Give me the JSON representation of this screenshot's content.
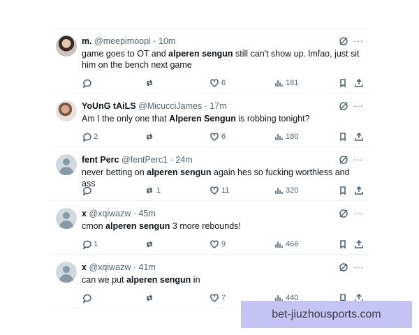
{
  "tweets": [
    {
      "name": "m.",
      "handle": "@meepimoopi",
      "time": "10m",
      "text_before": "game goes to OT and ",
      "highlight": "alperen sengun",
      "text_after": " still can't show up. lmfao, just sit him on the bench next game",
      "replies": "",
      "retweets": "",
      "likes": "6",
      "views": "181"
    },
    {
      "name": "YoUnG tAiLS",
      "handle": "@MicucciJames",
      "time": "17m",
      "text_before": "Am I the only one that ",
      "highlight": "Alperen Sengun",
      "text_after": " is robbing tonight?",
      "replies": "2",
      "retweets": "",
      "likes": "6",
      "views": "180"
    },
    {
      "name": "fent Perc",
      "handle": "@fentPerc1",
      "time": "24m",
      "text_before": "never betting on ",
      "highlight": "alperen sengun",
      "text_after": " again hes so fucking worthless and ass",
      "replies": "",
      "retweets": "1",
      "likes": "11",
      "views": "320"
    },
    {
      "name": "x",
      "handle": "@xqiwazw",
      "time": "45m",
      "text_before": "cmon ",
      "highlight": "alperen sengun",
      "text_after": " 3 more rebounds!",
      "replies": "1",
      "retweets": "",
      "likes": "9",
      "views": "466"
    },
    {
      "name": "x",
      "handle": "@xqiwazw",
      "time": "41m",
      "text_before": "can we put ",
      "highlight": "alperen sengun",
      "text_after": " in",
      "replies": "",
      "retweets": "",
      "likes": "7",
      "views": "440"
    }
  ],
  "separator": "·",
  "more_label": "···",
  "watermark": "bet-jiuzhousports.com",
  "icons": [
    "grok-icon",
    "more-icon",
    "reply-icon",
    "retweet-icon",
    "like-icon",
    "views-icon",
    "bookmark-icon",
    "share-icon"
  ]
}
